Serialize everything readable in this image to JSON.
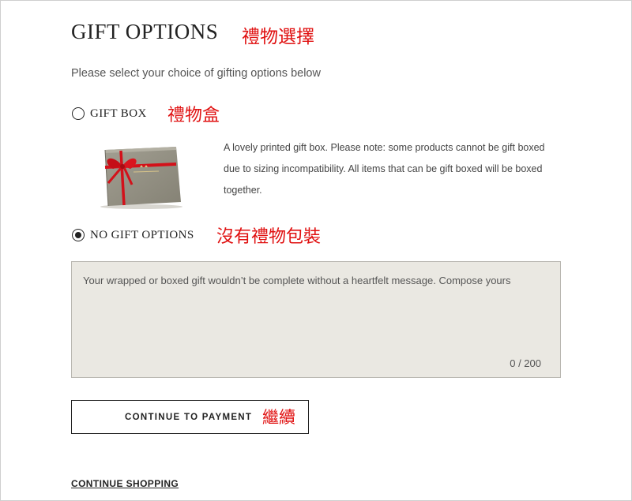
{
  "page": {
    "title": "GIFT OPTIONS",
    "subtitle": "Please select your choice of gifting options below"
  },
  "annotations": {
    "title": "禮物選擇",
    "gift_box": "禮物盒",
    "no_gift": "沒有禮物包裝",
    "continue": "繼續"
  },
  "options": [
    {
      "label": "GIFT BOX",
      "selected": false
    },
    {
      "label": "NO GIFT OPTIONS",
      "selected": true
    }
  ],
  "gift_box": {
    "description": "A lovely printed gift box. Please note: some products cannot be gift boxed due to sizing incompatibility. All items that can be gift boxed will be boxed together.",
    "image": "gift-box-with-red-ribbon"
  },
  "message": {
    "placeholder": "Your wrapped or boxed gift wouldn’t be complete without a heartfelt message. Compose yours",
    "value": "",
    "counter": "0 / 200"
  },
  "actions": {
    "continue_label": "CONTINUE TO PAYMENT",
    "shopping_link": "CONTINUE SHOPPING"
  },
  "colors": {
    "annotation": "#e01010",
    "message_bg": "#eae8e2",
    "box": "#8f8c7f",
    "ribbon": "#d3111a"
  }
}
